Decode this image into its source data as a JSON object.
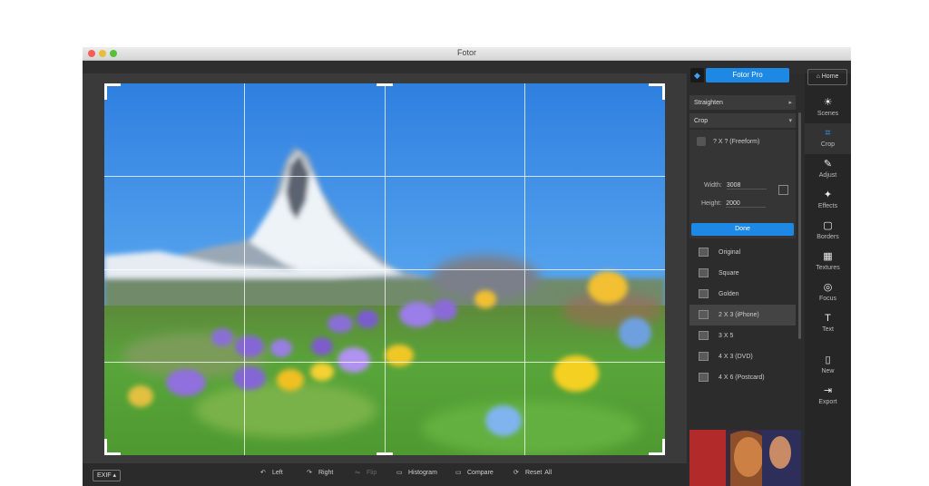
{
  "window": {
    "title": "Fotor"
  },
  "panel": {
    "pro_label": "Fotor Pro",
    "straighten_label": "Straighten",
    "crop_label": "Crop",
    "freeform_label": "? X ? (Freeform)",
    "width_label": "Width:",
    "width_value": "3008",
    "height_label": "Height:",
    "height_value": "2000",
    "done_label": "Done",
    "ratios": [
      {
        "label": "Original"
      },
      {
        "label": "Square"
      },
      {
        "label": "Golden"
      },
      {
        "label": "2 X 3 (iPhone)"
      },
      {
        "label": "3 X 5"
      },
      {
        "label": "4 X 3 (DVD)"
      },
      {
        "label": "4 X 6 (Postcard)"
      }
    ]
  },
  "rail": {
    "home_label": "Home",
    "tools": [
      {
        "label": "Scenes",
        "icon": "sun-icon"
      },
      {
        "label": "Crop",
        "icon": "crop-icon"
      },
      {
        "label": "Adjust",
        "icon": "pencil-icon"
      },
      {
        "label": "Effects",
        "icon": "sparkle-icon"
      },
      {
        "label": "Borders",
        "icon": "border-icon"
      },
      {
        "label": "Textures",
        "icon": "checker-icon"
      },
      {
        "label": "Focus",
        "icon": "focus-icon"
      },
      {
        "label": "Text",
        "icon": "text-icon"
      },
      {
        "label": "New",
        "icon": "new-file-icon"
      },
      {
        "label": "Export",
        "icon": "export-icon"
      }
    ]
  },
  "bottombar": {
    "exif_label": "EXIF",
    "left_label": "Left",
    "right_label": "Right",
    "flip_label": "Flip",
    "histogram_label": "Histogram",
    "compare_label": "Compare",
    "reset_label": "Reset",
    "all_label": "All"
  },
  "colors": {
    "accent": "#1e88e5",
    "dark_bg": "#2c2c2c",
    "canvas_bg": "#3a3a3a"
  }
}
